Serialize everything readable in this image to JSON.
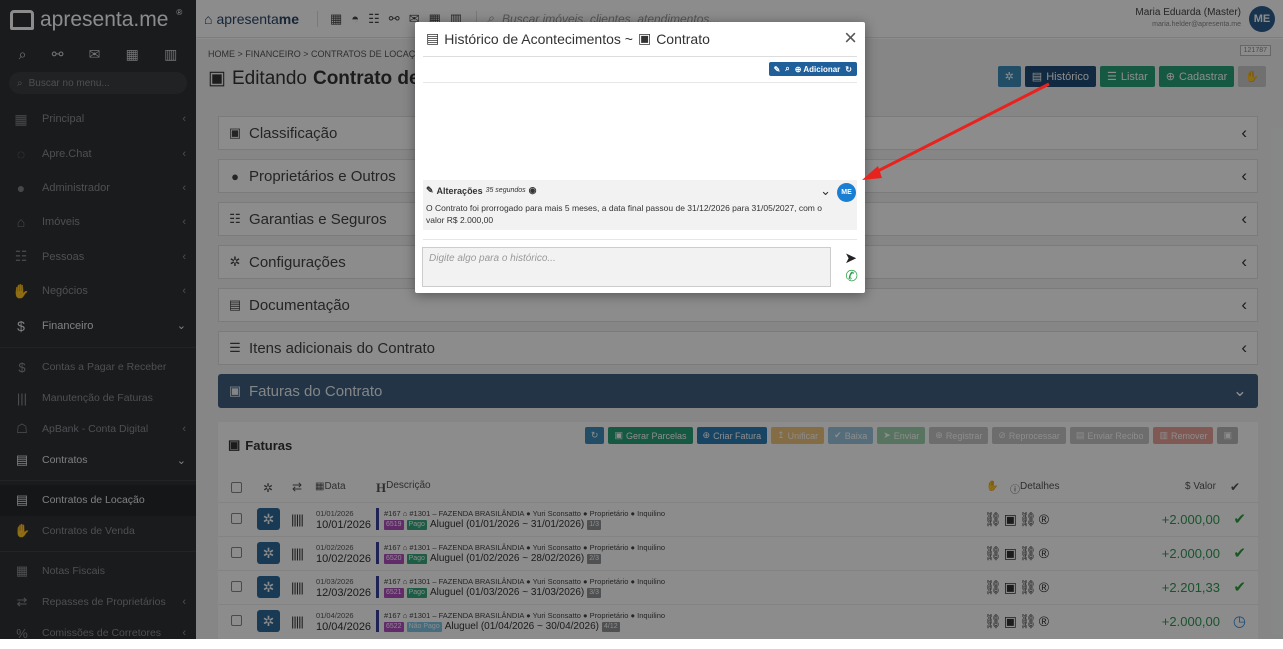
{
  "sidebar": {
    "brand": "apresenta.me",
    "brand_reg": "®",
    "search_placeholder": "Buscar no menu...",
    "items": [
      {
        "label": "Principal",
        "icon": "dashboard-icon",
        "glyph": "▦"
      },
      {
        "label": "Apre.Chat",
        "icon": "whatsapp-icon",
        "glyph": "◌"
      },
      {
        "label": "Administrador",
        "icon": "user-icon",
        "glyph": "●"
      },
      {
        "label": "Imóveis",
        "icon": "home-icon",
        "glyph": "⌂"
      },
      {
        "label": "Pessoas",
        "icon": "people-icon",
        "glyph": "☷"
      },
      {
        "label": "Negócios",
        "icon": "handshake-icon",
        "glyph": "✋"
      },
      {
        "label": "Financeiro",
        "icon": "dollar-icon",
        "glyph": "$"
      }
    ],
    "sub_items": [
      {
        "label": "Contas a Pagar e Receber",
        "icon": "dollar-icon",
        "glyph": "$"
      },
      {
        "label": "Manutenção de Faturas",
        "icon": "barcode-icon",
        "glyph": "|||"
      },
      {
        "label": "ApBank - Conta Digital",
        "icon": "bank-icon",
        "glyph": "☖"
      },
      {
        "label": "Contratos",
        "icon": "contract-icon",
        "glyph": "▤"
      },
      {
        "label": "Contratos de Locação",
        "icon": "contract-icon",
        "glyph": "▤"
      },
      {
        "label": "Contratos de Venda",
        "icon": "handshake-icon",
        "glyph": "✋"
      },
      {
        "label": "Notas Fiscais",
        "icon": "invoice-icon",
        "glyph": "▦"
      },
      {
        "label": "Repasses de Proprietários",
        "icon": "transfer-icon",
        "glyph": "⇄"
      },
      {
        "label": "Comissões de Corretores",
        "icon": "commission-icon",
        "glyph": "%"
      }
    ]
  },
  "topbar": {
    "brand": "apresenta",
    "brand_bold": "me",
    "search_placeholder": "Buscar imóveis, clientes, atendimentos...",
    "user_name": "Maria Eduarda (Master)",
    "user_email": "maria.helder@apresenta.me",
    "avatar": "ME"
  },
  "page": {
    "breadcrumb": "HOME  >  FINANCEIRO  >  CONTRATOS DE LOCAÇÃO",
    "id_badge": "121787",
    "title_prefix": "Editando",
    "title_bold": "Contrato de Locação",
    "actions": {
      "historico": "Histórico",
      "listar": "Listar",
      "cadastrar": "Cadastrar"
    }
  },
  "sections": [
    {
      "label": "Classificação",
      "glyph": "▣"
    },
    {
      "label": "Proprietários e Outros",
      "glyph": "●"
    },
    {
      "label": "Garantias e Seguros",
      "glyph": "☷"
    },
    {
      "label": "Configurações",
      "glyph": "✲"
    },
    {
      "label": "Documentação",
      "glyph": "▤"
    },
    {
      "label": "Itens adicionais do Contrato",
      "glyph": "☰"
    },
    {
      "label": "Faturas do Contrato",
      "glyph": "▣"
    }
  ],
  "faturas": {
    "title": "Faturas",
    "buttons": [
      "Gerar Parcelas",
      "Criar Fatura",
      "Unificar",
      "Baixa",
      "Enviar",
      "Registrar",
      "Reprocessar",
      "Enviar Recibo",
      "Remover"
    ],
    "headers": {
      "data": "Data",
      "descricao": "Descrição",
      "detalhes": "Detalhes",
      "valor": "$ Valor"
    },
    "rows": [
      {
        "date_small": "01/01/2026",
        "date": "10/01/2026",
        "line1": "#167 ⌂ #1301 – FAZENDA BRASILÂNDIA ● Yuri Sconsatto ● Proprietário ● Inquilino",
        "tag1": "6519",
        "tag2": "Pago",
        "desc": "Aluguel (01/01/2026 ~ 31/01/2026)",
        "tag3": "1/3",
        "value": "+2.000,00",
        "status": "✔"
      },
      {
        "date_small": "01/02/2026",
        "date": "10/02/2026",
        "line1": "#167 ⌂ #1301 – FAZENDA BRASILÂNDIA ● Yuri Sconsatto ● Proprietário ● Inquilino",
        "tag1": "6520",
        "tag2": "Pago",
        "desc": "Aluguel (01/02/2026 ~ 28/02/2026)",
        "tag3": "2/3",
        "value": "+2.000,00",
        "status": "✔"
      },
      {
        "date_small": "01/03/2026",
        "date": "12/03/2026",
        "line1": "#167 ⌂ #1301 – FAZENDA BRASILÂNDIA ● Yuri Sconsatto ● Proprietário ● Inquilino",
        "tag1": "6521",
        "tag2": "Pago",
        "desc": "Aluguel (01/03/2026 ~ 31/03/2026)",
        "tag3": "3/3",
        "value": "+2.201,33",
        "status": "✔"
      },
      {
        "date_small": "01/04/2026",
        "date": "10/04/2026",
        "line1": "#167 ⌂ #1301 – FAZENDA BRASILÂNDIA ● Yuri Sconsatto ● Proprietário ● Inquilino",
        "tag1": "6522",
        "tag2": "Não Pago",
        "desc": "Aluguel (01/04/2026 ~ 30/04/2026)",
        "tag3": "4/12",
        "value": "+2.000,00",
        "status": "◷"
      }
    ]
  },
  "modal": {
    "title": "Histórico de Acontecimentos ~",
    "title_context": "Contrato",
    "toolbar_add": "Adicionar",
    "entry_title": "Alterações",
    "entry_time": "35 segundos",
    "entry_text": "O Contrato foi prorrogado para mais 5 meses, a data final passou de 31/12/2026 para 31/05/2027, com o valor R$ 2.000,00",
    "entry_avatar": "ME",
    "input_placeholder": "Digite algo para o histórico..."
  },
  "colors": {
    "accent": "#1f4e79",
    "sidebar": "#2f3235",
    "success": "#2f9a52",
    "arrow": "#e8231d"
  }
}
